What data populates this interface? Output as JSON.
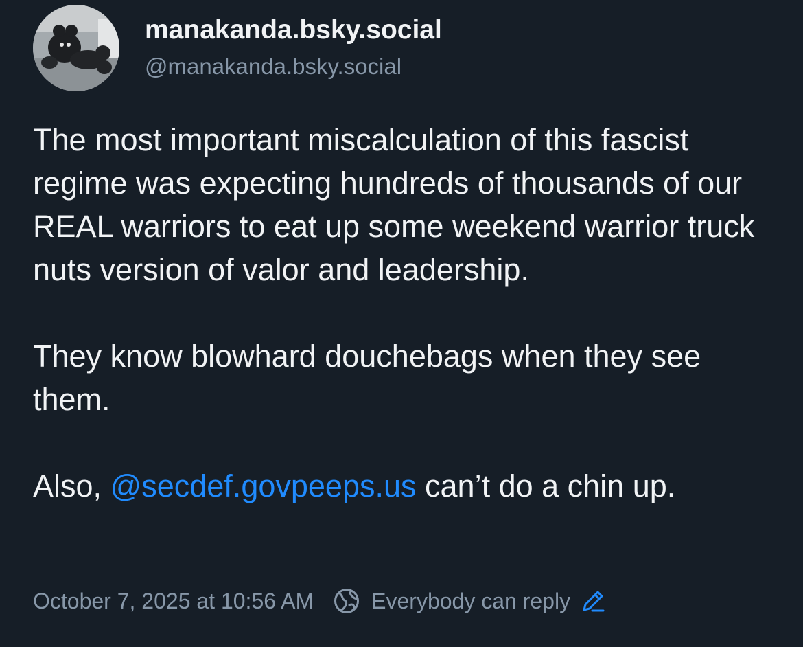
{
  "author": {
    "display_name": "manakanda.bsky.social",
    "handle": "@manakanda.bsky.social",
    "avatar_icon": "avatar-photo"
  },
  "post": {
    "paragraph_1": "The most important miscalculation of this fascist regime was expecting hundreds of thousands of our REAL warriors to eat up some weekend warrior truck nuts version of valor and leadership.",
    "paragraph_2": "They know blowhard douchebags when they see them.",
    "paragraph_3_prefix": "Also, ",
    "paragraph_3_mention": "@secdef.govpeeps.us",
    "paragraph_3_suffix": " can’t do a chin up."
  },
  "meta": {
    "timestamp": "October 7, 2025 at 10:56 AM",
    "reply_setting": "Everybody can reply",
    "globe_icon": "globe-icon",
    "edit_icon": "pencil-icon"
  },
  "colors": {
    "background": "#161e27",
    "text": "#f1f3f5",
    "muted": "#8797a8",
    "link": "#208bfe"
  }
}
